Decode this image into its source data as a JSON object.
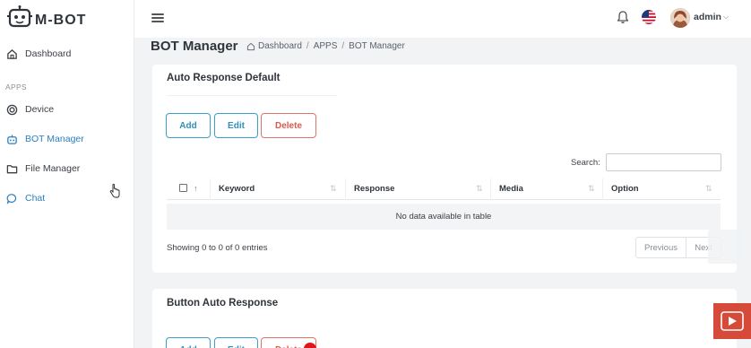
{
  "brand": {
    "logo_text": "M-BOT"
  },
  "sidebar": {
    "section_apps": "APPS",
    "items": [
      {
        "label": "Dashboard",
        "icon": "home-icon"
      },
      {
        "label": "Device",
        "icon": "target-icon"
      },
      {
        "label": "BOT Manager",
        "icon": "robot-icon"
      },
      {
        "label": "File Manager",
        "icon": "folder-icon"
      },
      {
        "label": "Chat",
        "icon": "chat-icon"
      }
    ]
  },
  "topbar": {
    "user_name": "admin"
  },
  "page": {
    "title": "BOT Manager",
    "breadcrumb": [
      "Dashboard",
      "APPS",
      "BOT Manager"
    ]
  },
  "auto_response": {
    "title": "Auto Response Default",
    "buttons": {
      "add": "Add",
      "edit": "Edit",
      "delete": "Delete"
    },
    "search_label": "Search:",
    "search_value": "",
    "columns": [
      "Keyword",
      "Response",
      "Media",
      "Option"
    ],
    "empty_text": "No data available in table",
    "info": "Showing 0 to 0 of 0 entries",
    "pager": {
      "previous": "Previous",
      "next": "Next"
    }
  },
  "button_auto_response": {
    "title": "Button Auto Response",
    "buttons": {
      "add": "Add",
      "edit": "Edit",
      "delete": "Delete"
    }
  },
  "colors": {
    "accent": "#2b7fc0",
    "info": "#3a9fc9",
    "danger": "#e07468",
    "background": "#f1f3f5"
  }
}
